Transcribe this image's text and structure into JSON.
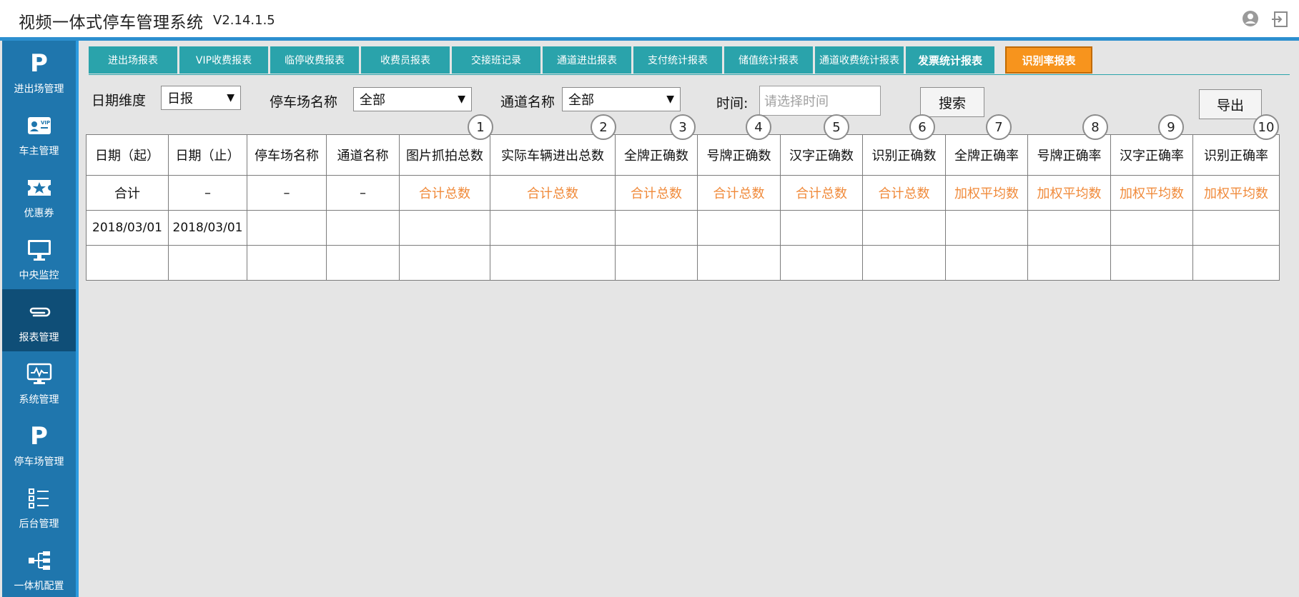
{
  "header": {
    "title": "视频一体式停车管理系统",
    "version": "V2.14.1.5"
  },
  "sidebar": {
    "items": [
      {
        "label": "进出场管理",
        "icon": "parking-p-icon"
      },
      {
        "label": "车主管理",
        "icon": "vip-card-icon"
      },
      {
        "label": "优惠券",
        "icon": "coupon-star-icon"
      },
      {
        "label": "中央监控",
        "icon": "monitor-icon"
      },
      {
        "label": "报表管理",
        "icon": "paperclip-icon",
        "active": true
      },
      {
        "label": "系统管理",
        "icon": "system-monitor-icon"
      },
      {
        "label": "停车场管理",
        "icon": "parking-p-icon"
      },
      {
        "label": "后台管理",
        "icon": "list-icon"
      },
      {
        "label": "一体机配置",
        "icon": "network-tree-icon"
      }
    ]
  },
  "tabs": [
    {
      "label": "进出场报表"
    },
    {
      "label": "VIP收费报表"
    },
    {
      "label": "临停收费报表"
    },
    {
      "label": "收费员报表"
    },
    {
      "label": "交接班记录"
    },
    {
      "label": "通道进出报表"
    },
    {
      "label": "支付统计报表"
    },
    {
      "label": "储值统计报表"
    },
    {
      "label": "通道收费统计报表"
    },
    {
      "label": "发票统计报表"
    },
    {
      "label": "识别率报表",
      "active": true
    }
  ],
  "filters": {
    "date_dimension_label": "日期维度",
    "date_dimension_value": "日报",
    "parking_lot_label": "停车场名称",
    "parking_lot_value": "全部",
    "channel_label": "通道名称",
    "channel_value": "全部",
    "time_label": "时间:",
    "time_placeholder": "请选择时间",
    "search_button": "搜索",
    "export_button": "导出"
  },
  "table": {
    "headers": [
      "日期（起）",
      "日期（止）",
      "停车场名称",
      "通道名称",
      "图片抓拍总数",
      "实际车辆进出总数",
      "全牌正确数",
      "号牌正确数",
      "汉字正确数",
      "识别正确数",
      "全牌正确率",
      "号牌正确率",
      "汉字正确率",
      "识别正确率"
    ],
    "summary_row": [
      "合计",
      "–",
      "–",
      "–",
      "合计总数",
      "合计总数",
      "合计总数",
      "合计总数",
      "合计总数",
      "合计总数",
      "加权平均数",
      "加权平均数",
      "加权平均数",
      "加权平均数"
    ],
    "rows": [
      [
        "2018/03/01",
        "2018/03/01",
        "",
        "",
        "",
        "",
        "",
        "",
        "",
        "",
        "",
        "",
        "",
        ""
      ],
      [
        "",
        "",
        "",
        "",
        "",
        "",
        "",
        "",
        "",
        "",
        "",
        "",
        "",
        ""
      ]
    ]
  },
  "annotations": [
    "1",
    "2",
    "3",
    "4",
    "5",
    "6",
    "7",
    "8",
    "9",
    "10"
  ],
  "colors": {
    "sidebar": "#1f76ad",
    "sidebar_active": "#0f4e77",
    "tab": "#2aa3ab",
    "tab_active": "#f7941d",
    "highlight_text": "#f08a3a",
    "header_line": "#2c8fcf"
  }
}
